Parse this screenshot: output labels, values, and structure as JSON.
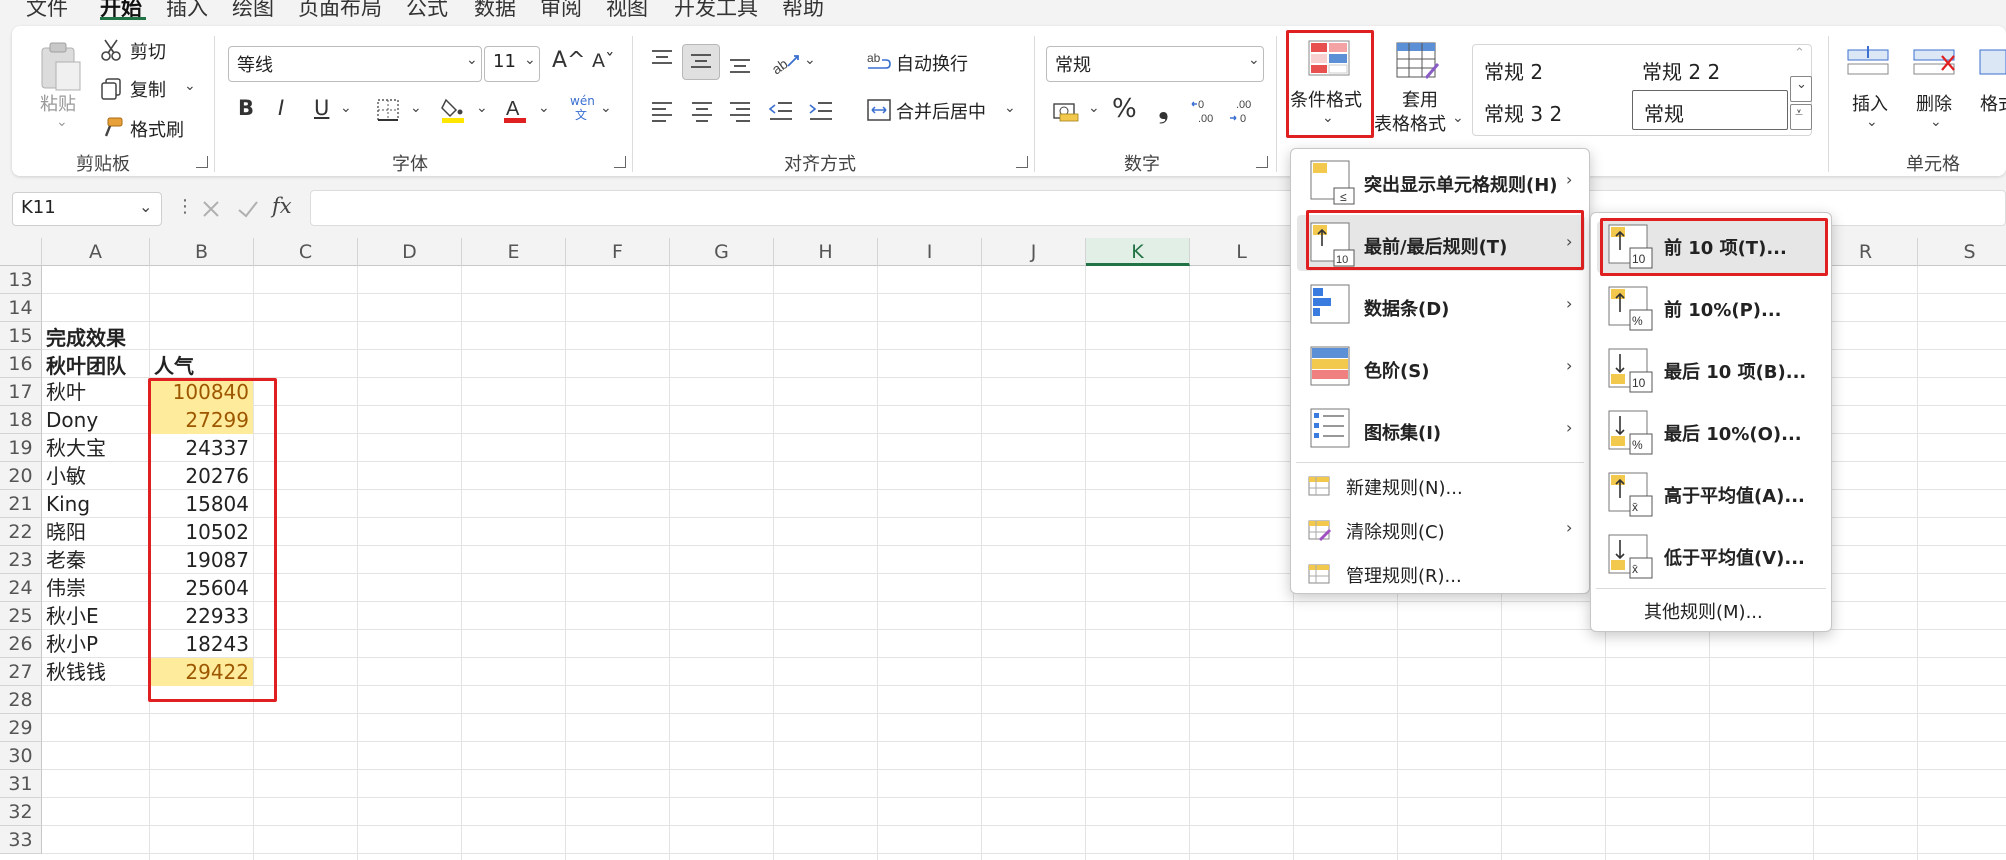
{
  "menu_tabs": [
    "文件",
    "开始",
    "插入",
    "绘图",
    "页面布局",
    "公式",
    "数据",
    "审阅",
    "视图",
    "开发工具",
    "帮助"
  ],
  "active_tab": "开始",
  "ribbon": {
    "clipboard": {
      "paste": "粘贴",
      "cut": "剪切",
      "copy": "复制",
      "format_painter": "格式刷",
      "label": "剪贴板"
    },
    "font": {
      "name": "等线",
      "size": "11",
      "label": "字体",
      "bold": "B",
      "italic": "I",
      "underline": "U",
      "grow": "A^",
      "shrink": "Aˇ",
      "phonetic": "wén 文"
    },
    "alignment": {
      "wrap": "自动换行",
      "merge": "合并后居中",
      "label": "对齐方式"
    },
    "number": {
      "format": "常规",
      "percent": "%",
      "comma": "❟",
      "label": "数字"
    },
    "styles": {
      "conditional": "条件格式",
      "table_line1": "套用",
      "table_line2": "表格格式"
    },
    "style_gallery": [
      "常规 2",
      "常规 2 2",
      "常规 3 2",
      "常规"
    ],
    "cells": {
      "insert": "插入",
      "delete": "删除",
      "format": "格式",
      "label": "单元格"
    }
  },
  "formula_bar": {
    "name_box": "K11",
    "fx": "fx",
    "value": ""
  },
  "columns": [
    "A",
    "B",
    "C",
    "D",
    "E",
    "F",
    "G",
    "H",
    "I",
    "J",
    "K",
    "L",
    "M",
    "N",
    "O",
    "P",
    "Q",
    "R",
    "S"
  ],
  "selected_column": "K",
  "rows": [
    "13",
    "14",
    "15",
    "16",
    "17",
    "18",
    "19",
    "20",
    "21",
    "22",
    "23",
    "24",
    "25",
    "26",
    "27",
    "28",
    "29",
    "30",
    "31",
    "32",
    "33"
  ],
  "sheet": {
    "title": "完成效果",
    "header_a": "秋叶团队",
    "header_b": "人气",
    "data": [
      {
        "name": "秋叶",
        "value": "100840",
        "highlight": true
      },
      {
        "name": "Dony",
        "value": "27299",
        "highlight": true
      },
      {
        "name": "秋大宝",
        "value": "24337",
        "highlight": false
      },
      {
        "name": "小敏",
        "value": "20276",
        "highlight": false
      },
      {
        "name": "King",
        "value": "15804",
        "highlight": false
      },
      {
        "name": "晓阳",
        "value": "10502",
        "highlight": false
      },
      {
        "name": "老秦",
        "value": "19087",
        "highlight": false
      },
      {
        "name": "伟崇",
        "value": "25604",
        "highlight": false
      },
      {
        "name": "秋小E",
        "value": "22933",
        "highlight": false
      },
      {
        "name": "秋小P",
        "value": "18243",
        "highlight": false
      },
      {
        "name": "秋钱钱",
        "value": "29422",
        "highlight": true
      }
    ]
  },
  "cf_menu": {
    "items": [
      {
        "label": "突出显示单元格规则(H)",
        "icon": "highlight-cells-icon",
        "submenu": true
      },
      {
        "label": "最前/最后规则(T)",
        "icon": "top-bottom-icon",
        "submenu": true
      },
      {
        "label": "数据条(D)",
        "icon": "data-bars-icon",
        "submenu": true
      },
      {
        "label": "色阶(S)",
        "icon": "color-scales-icon",
        "submenu": true
      },
      {
        "label": "图标集(I)",
        "icon": "icon-sets-icon",
        "submenu": true
      }
    ],
    "actions": [
      {
        "label": "新建规则(N)...",
        "icon": "new-rule-icon",
        "submenu": false
      },
      {
        "label": "清除规则(C)",
        "icon": "clear-rules-icon",
        "submenu": true
      },
      {
        "label": "管理规则(R)...",
        "icon": "manage-rules-icon",
        "submenu": false
      }
    ]
  },
  "topbottom_menu": {
    "items": [
      {
        "label": "前 10 项(T)...",
        "badge": "10",
        "dir": "up"
      },
      {
        "label": "前 10%(P)...",
        "badge": "%",
        "dir": "up"
      },
      {
        "label": "最后 10 项(B)...",
        "badge": "10",
        "dir": "down"
      },
      {
        "label": "最后 10%(O)...",
        "badge": "%",
        "dir": "down"
      },
      {
        "label": "高于平均值(A)...",
        "badge": "x̄",
        "dir": "up"
      },
      {
        "label": "低于平均值(V)...",
        "badge": "x̄",
        "dir": "down"
      }
    ],
    "more": "其他规则(M)..."
  },
  "colors": {
    "accent": "#217346",
    "highlight_fill": "#ffeb9c",
    "highlight_text": "#9c5700",
    "annotation": "#e02020"
  }
}
